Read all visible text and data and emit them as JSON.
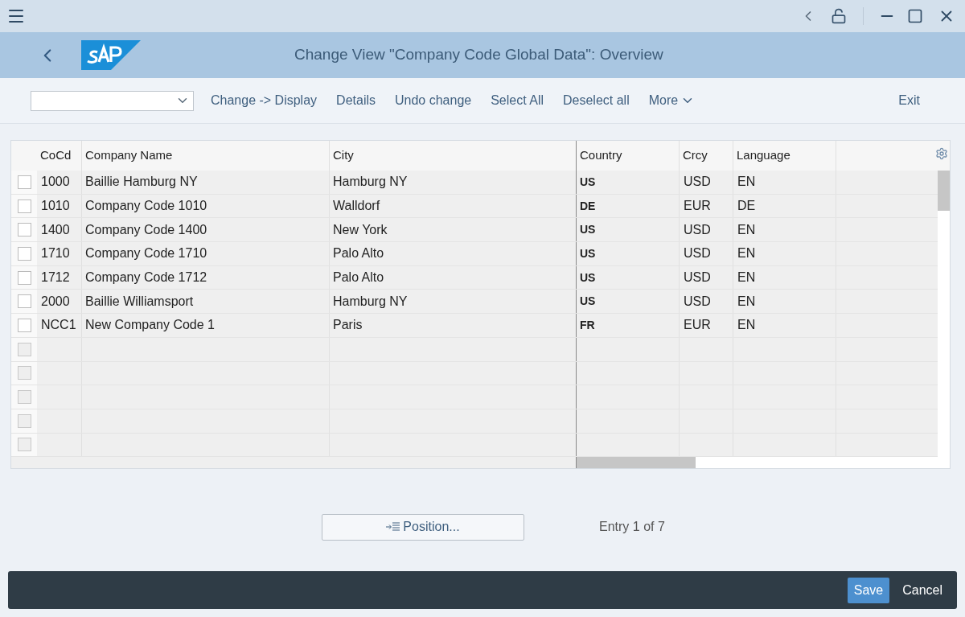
{
  "window": {
    "title": "Change View \"Company Code Global Data\": Overview"
  },
  "toolbar": {
    "actions": [
      "Change -> Display",
      "Details",
      "Undo change",
      "Select All",
      "Deselect all"
    ],
    "more": "More",
    "exit": "Exit"
  },
  "table": {
    "columns": [
      "CoCd",
      "Company Name",
      "City",
      "Country",
      "Crcy",
      "Language"
    ],
    "rows": [
      {
        "selected": false,
        "cells": [
          "1000",
          "Baillie Hamburg NY",
          "Hamburg NY",
          "US",
          "USD",
          "EN"
        ]
      },
      {
        "selected": false,
        "cells": [
          "1010",
          "Company Code 1010",
          "Walldorf",
          "DE",
          "EUR",
          "DE"
        ]
      },
      {
        "selected": false,
        "cells": [
          "1400",
          "Company Code 1400",
          "New York",
          "US",
          "USD",
          "EN"
        ]
      },
      {
        "selected": false,
        "cells": [
          "1710",
          "Company Code 1710",
          "Palo Alto",
          "US",
          "USD",
          "EN"
        ]
      },
      {
        "selected": false,
        "cells": [
          "1712",
          "Company Code 1712",
          "Palo Alto",
          "US",
          "USD",
          "EN"
        ]
      },
      {
        "selected": false,
        "cells": [
          "2000",
          "Baillie Williamsport",
          "Hamburg NY",
          "US",
          "USD",
          "EN"
        ]
      },
      {
        "selected": false,
        "cells": [
          "NCC1",
          "New Company Code 1",
          "Paris",
          "FR",
          "EUR",
          "EN"
        ]
      },
      {
        "selected": false,
        "disabled": true
      },
      {
        "selected": false,
        "disabled": true
      },
      {
        "selected": false,
        "disabled": true
      },
      {
        "selected": false,
        "disabled": true
      },
      {
        "selected": false,
        "disabled": true
      }
    ]
  },
  "position_button": "Position...",
  "entry_info": "Entry 1 of 7",
  "footer": {
    "save": "Save",
    "cancel": "Cancel"
  }
}
